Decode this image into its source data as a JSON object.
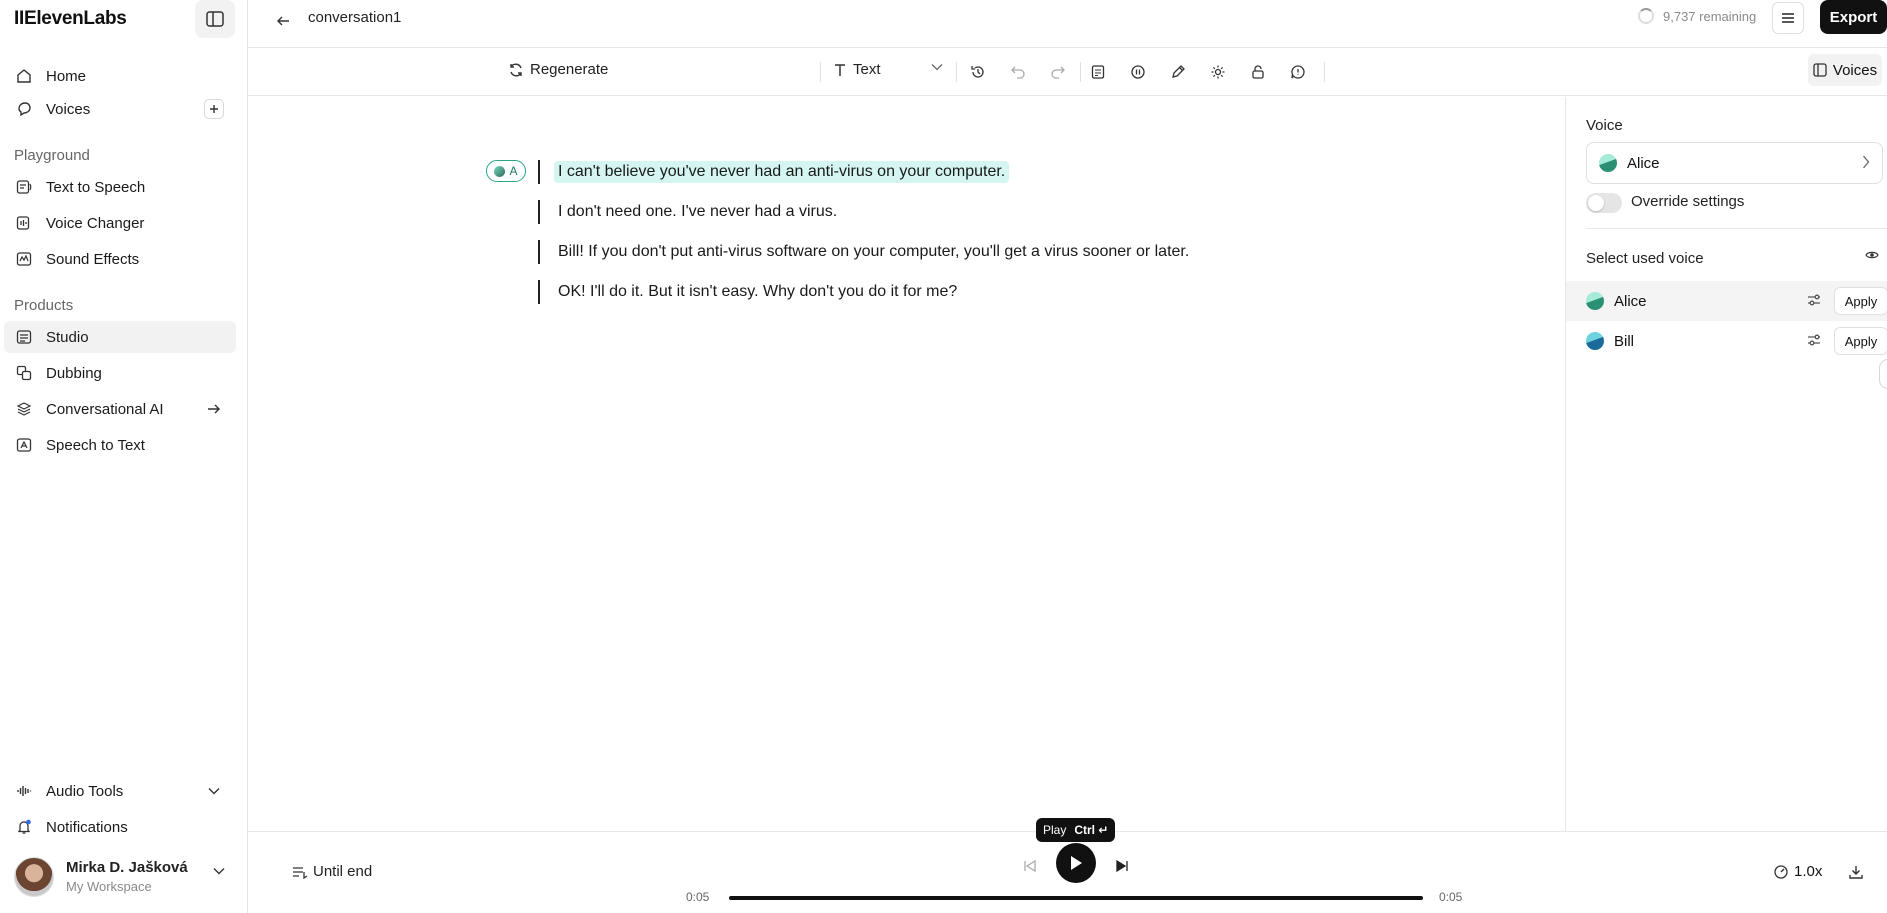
{
  "brand": {
    "logo": "IIElevenLabs"
  },
  "sidebar": {
    "home": "Home",
    "voices": "Voices",
    "playground_label": "Playground",
    "playground": [
      "Text to Speech",
      "Voice Changer",
      "Sound Effects"
    ],
    "products_label": "Products",
    "products": [
      "Studio",
      "Dubbing",
      "Conversational AI",
      "Speech to Text"
    ],
    "active_item": "Studio",
    "audio_tools": "Audio Tools",
    "notifications": "Notifications",
    "user": {
      "name": "Mirka D. Jašková",
      "workspace": "My Workspace"
    }
  },
  "header": {
    "project_title": "conversation1",
    "credits_remaining": "9,737 remaining",
    "export_label": "Export"
  },
  "toolbar": {
    "regenerate_label": "Regenerate",
    "block_type": "Text",
    "voices_label": "Voices"
  },
  "editor": {
    "speaker_badge": "A",
    "lines": [
      "I can't believe you've never had an anti-virus on your computer.",
      "I don't need one. I've never had a virus.",
      "Bill! If you don't put anti-virus software on your computer, you'll get a virus sooner or later.",
      "OK! I'll do it. But it isn't easy. Why don't you do it for me?"
    ]
  },
  "voice_panel": {
    "voice_label": "Voice",
    "selected_voice": "Alice",
    "override_label": "Override settings",
    "override_enabled": false,
    "used_voices_label": "Select used voice",
    "used_voices": [
      {
        "name": "Alice",
        "apply_label": "Apply"
      },
      {
        "name": "Bill",
        "apply_label": "Apply"
      }
    ]
  },
  "player": {
    "until_end_label": "Until end",
    "tooltip_label": "Play",
    "tooltip_shortcut": "Ctrl ↵",
    "current_time": "0:05",
    "total_time": "0:05",
    "speed": "1.0x"
  },
  "colors": {
    "highlight": "#d4f5f1",
    "accent": "#2aa58a",
    "primary": "#111111"
  }
}
